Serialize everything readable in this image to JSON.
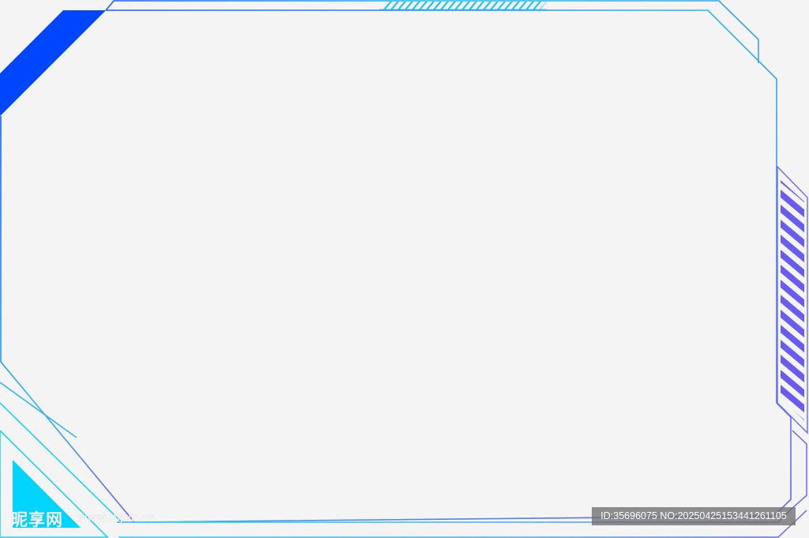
{
  "frame": {
    "description_colors": {
      "primary_blue": "#0046ff",
      "cyan": "#1fd2f2",
      "sky": "#3aa0f0",
      "violet": "#6a5cf0",
      "background": "#f4f4f4"
    },
    "icons": [
      "corner-triangle-icon",
      "stripe-pattern-icon"
    ]
  },
  "watermark": {
    "logo_text": "昵享网",
    "site_url": "www.nipic.cn",
    "id_text": "ID:35696075 NO:20250425153441261105"
  }
}
